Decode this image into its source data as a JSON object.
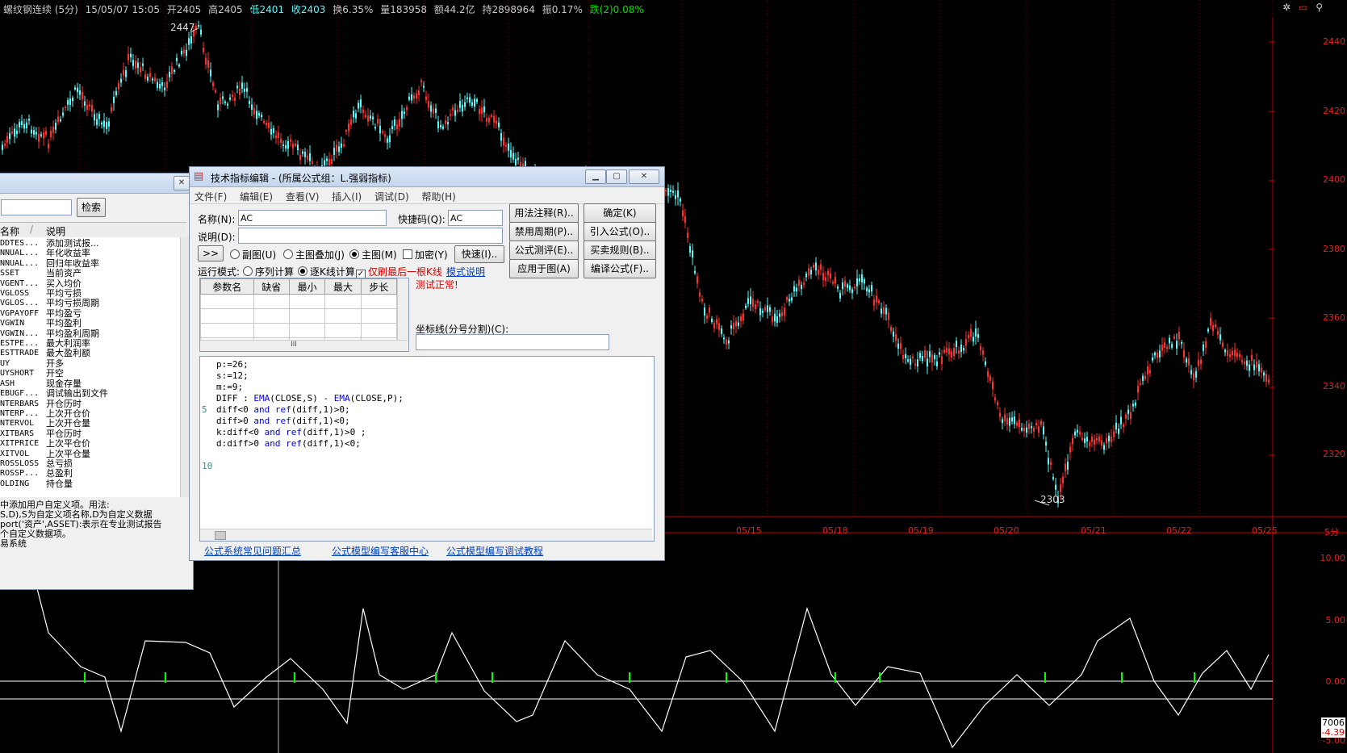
{
  "header": {
    "instrument": "螺纹钢连续 (5分)",
    "datetime": "15/05/07 15:05",
    "open": "开2405",
    "high": "高2405",
    "low": "低2401",
    "close": "收2403",
    "turnover": "换6.35%",
    "volume": "量183958",
    "amount": "额44.2亿",
    "position": "持2898964",
    "amplitude": "振0.17%",
    "change": "跌(2)0.08%"
  },
  "price_axis": [
    "2440",
    "2420",
    "2400",
    "2380",
    "2360",
    "2340",
    "2320"
  ],
  "price_markers": {
    "high": "2447",
    "low": "2303"
  },
  "date_axis": [
    "05/15",
    "05/18",
    "05/19",
    "05/20",
    "05/21",
    "05/22",
    "05/25"
  ],
  "period_label": "5分",
  "indicator_axis": [
    "10.00",
    "5.00",
    "0.00",
    "-5.00"
  ],
  "indicator_values": {
    "v1": "7006",
    "v2": "-4.39"
  },
  "colors": {
    "up": "#ff3030",
    "down": "#54fcfc",
    "axis": "#c00000",
    "indicator": "#ffffff",
    "signal": "#00ff00"
  },
  "left_panel": {
    "search_button": "检索",
    "col_name": "名称",
    "col_desc": "说明",
    "items": [
      {
        "name": "DDTES...",
        "desc": "添加测试报..."
      },
      {
        "name": "NNUAL...",
        "desc": "年化收益率"
      },
      {
        "name": "NNUAL...",
        "desc": "回归年收益率"
      },
      {
        "name": "SSET",
        "desc": "当前资产"
      },
      {
        "name": "VGENT...",
        "desc": "买入均价"
      },
      {
        "name": "VGLOSS",
        "desc": "平均亏损"
      },
      {
        "name": "VGLOS...",
        "desc": "平均亏损周期"
      },
      {
        "name": "VGPAYOFF",
        "desc": "平均盈亏"
      },
      {
        "name": "VGWIN",
        "desc": "平均盈利"
      },
      {
        "name": "VGWIN...",
        "desc": "平均盈利周期"
      },
      {
        "name": "ESTPE...",
        "desc": "最大利润率"
      },
      {
        "name": "ESTTRADE",
        "desc": "最大盈利额"
      },
      {
        "name": "UY",
        "desc": "开多"
      },
      {
        "name": "UYSHORT",
        "desc": "开空"
      },
      {
        "name": "ASH",
        "desc": "现金存量"
      },
      {
        "name": "EBUGF...",
        "desc": "调试输出到文件"
      },
      {
        "name": "NTERBARS",
        "desc": "开仓历时"
      },
      {
        "name": "NTERP...",
        "desc": "上次开仓价"
      },
      {
        "name": "NTERVOL",
        "desc": "上次开仓量"
      },
      {
        "name": "XITBARS",
        "desc": "平仓历时"
      },
      {
        "name": "XITPRICE",
        "desc": "上次平仓价"
      },
      {
        "name": "XITVOL",
        "desc": "上次平仓量"
      },
      {
        "name": "ROSSLOSS",
        "desc": "总亏损"
      },
      {
        "name": "ROSSP...",
        "desc": "总盈利"
      },
      {
        "name": "OLDING",
        "desc": "持仓量"
      }
    ],
    "help_lines": [
      "中添加用户自定义项。用法:",
      "S,D),S为自定义项名称,D为自定义数据",
      "port('资产',ASSET):表示在专业测试报告",
      "个自定义数据项。",
      "易系统"
    ]
  },
  "editor": {
    "title": "技术指标编辑 - (所属公式组：L.强弱指标)",
    "menu": [
      "文件(F)",
      "编辑(E)",
      "查看(V)",
      "插入(I)",
      "调试(D)",
      "帮助(H)"
    ],
    "name_label": "名称(N):",
    "name_value": "AC",
    "shortcut_label": "快捷码(Q):",
    "shortcut_value": "AC",
    "desc_label": "说明(D):",
    "desc_value": "",
    "expand": ">>",
    "radio_sub": "副图(U)",
    "radio_overlay": "主图叠加(J)",
    "radio_main": "主图(M)",
    "chk_encrypt": "加密(Y)",
    "fast_button": "快速(I)..",
    "run_mode_label": "运行模式:",
    "run_seq": "序列计算",
    "run_bar": "逐K线计算",
    "only_last": "仅刷最后一根K线",
    "mode_help": "模式说明",
    "params_headers": [
      "参数名",
      "缺省",
      "最小",
      "最大",
      "步长"
    ],
    "test_status": "测试正常!",
    "coord_label": "坐标线(分号分割)(C):",
    "coord_value": "",
    "buttons": {
      "usage": "用法注释(R)..",
      "ok": "确定(K)",
      "disable_period": "禁用周期(P)..",
      "import": "引入公式(O)..",
      "evaluate": "公式测评(E)..",
      "trade_rule": "买卖规则(B)..",
      "apply": "应用于图(A)",
      "compile": "编译公式(F).."
    },
    "code_lines": [
      [
        {
          "t": "p:=26;"
        }
      ],
      [
        {
          "t": "s:=12;"
        }
      ],
      [
        {
          "t": "m:=9;"
        }
      ],
      [
        {
          "t": "DIFF : "
        },
        {
          "t": "EMA",
          "k": 1
        },
        {
          "t": "(CLOSE,S) - "
        },
        {
          "t": "EMA",
          "k": 1
        },
        {
          "t": "(CLOSE,P);"
        }
      ],
      [
        {
          "t": "diff<0 "
        },
        {
          "t": "and",
          "k": 1
        },
        {
          "t": " "
        },
        {
          "t": "ref",
          "k": 1
        },
        {
          "t": "(diff,1)>0;"
        }
      ],
      [
        {
          "t": "diff>0 "
        },
        {
          "t": "and",
          "k": 1
        },
        {
          "t": " "
        },
        {
          "t": "ref",
          "k": 1
        },
        {
          "t": "(diff,1)<0;"
        }
      ],
      [
        {
          "t": "k:diff<0 "
        },
        {
          "t": "and",
          "k": 1
        },
        {
          "t": " "
        },
        {
          "t": "ref",
          "k": 1
        },
        {
          "t": "(diff,1)>0 ;"
        }
      ],
      [
        {
          "t": "d:diff>0 "
        },
        {
          "t": "and",
          "k": 1
        },
        {
          "t": " "
        },
        {
          "t": "ref",
          "k": 1
        },
        {
          "t": "(diff,1)<0;"
        }
      ]
    ],
    "line_numbers": [
      "5",
      "10"
    ],
    "links": [
      "公式系统常见问题汇总",
      "公式模型编写客服中心",
      "公式模型编写调试教程"
    ]
  }
}
